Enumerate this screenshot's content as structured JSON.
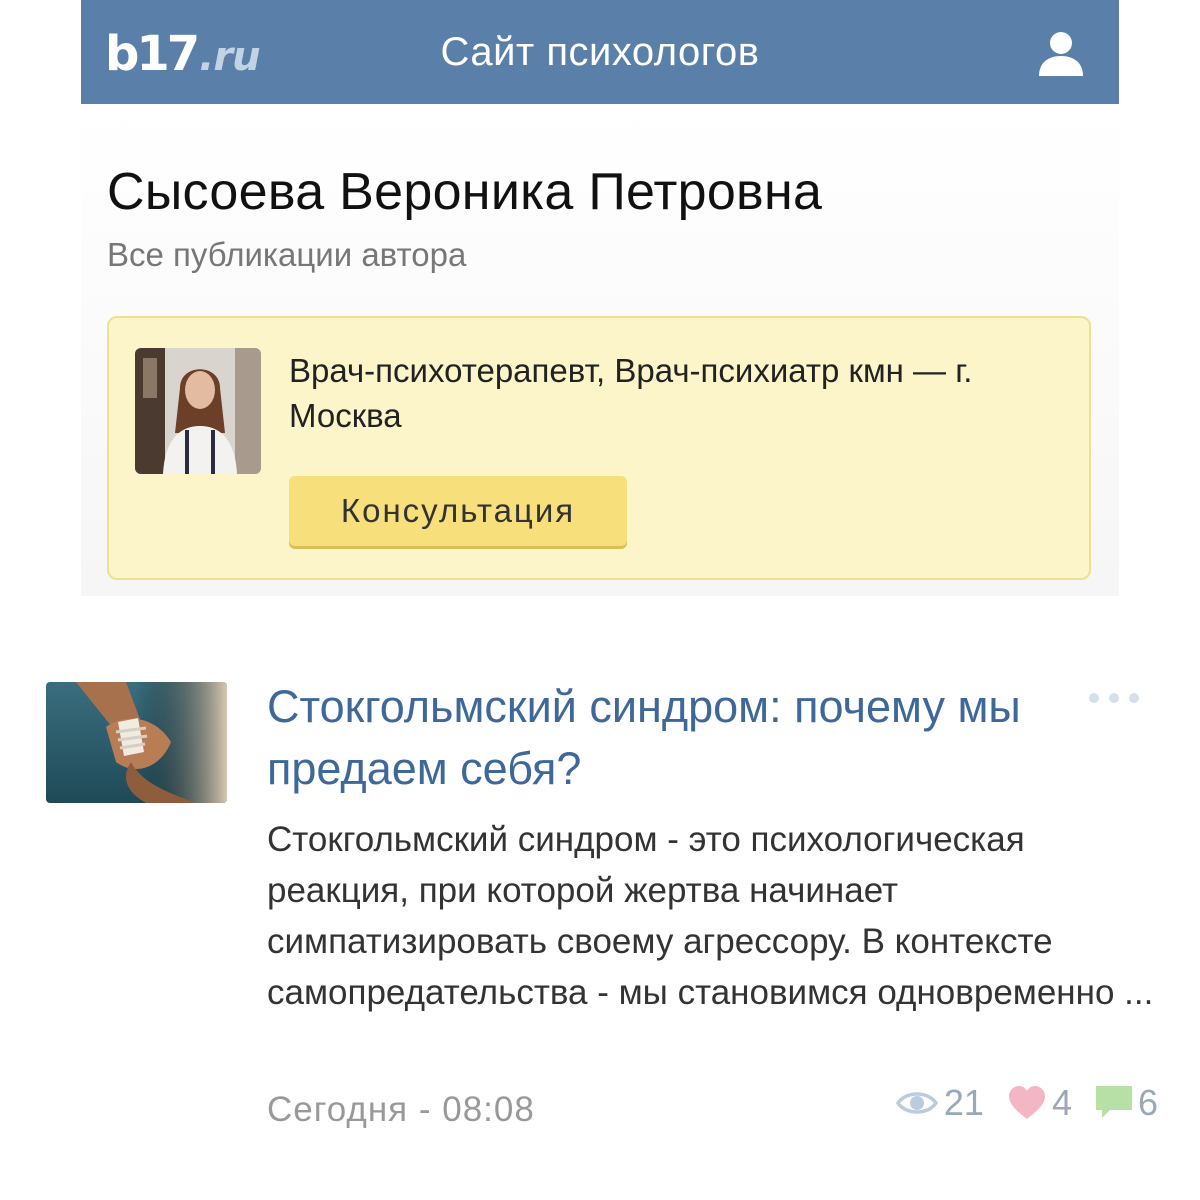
{
  "header": {
    "logo_main": "b17",
    "logo_domain": ".ru",
    "site_title": "Сайт психологов",
    "user_icon": "user-icon"
  },
  "author": {
    "name": "Сысоева Вероника Петровна",
    "subtitle": "Все публикации автора",
    "specialization": "Врач-психотерапевт, Врач-психиатр кмн — г. Москва",
    "consult_label": "Консультация"
  },
  "article": {
    "title": "Стокгольмский синдром: почему мы предаем себя?",
    "excerpt": "Стокгольмский синдром - это психологическая реакция, при которой жертва начинает симпатизировать своему агрессору. В контексте самопредательства - мы становимся одновременно ...",
    "date": "Сегодня - 08:08",
    "views": "21",
    "likes": "4",
    "comments": "6"
  },
  "colors": {
    "header_bg": "#5a7fa8",
    "card_bg": "#fbf5c9",
    "button_bg": "#f7df7c",
    "title_link": "#3f689a",
    "like": "#f2b6c4",
    "comment": "#b6e0a6",
    "views": "#b9cce0"
  }
}
